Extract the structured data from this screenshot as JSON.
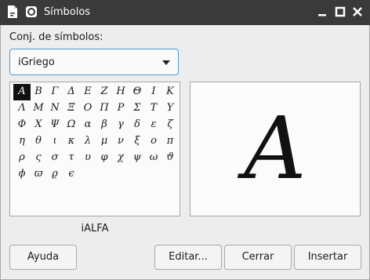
{
  "window": {
    "title": "Símbolos"
  },
  "symbol_set": {
    "label": "Conj. de símbolos:",
    "selected": "iGriego"
  },
  "symbols": [
    "Α",
    "Β",
    "Γ",
    "Δ",
    "Ε",
    "Ζ",
    "Η",
    "Θ",
    "Ι",
    "Κ",
    "Λ",
    "Μ",
    "Ν",
    "Ξ",
    "Ο",
    "Π",
    "Ρ",
    "Σ",
    "Τ",
    "Υ",
    "Φ",
    "Χ",
    "Ψ",
    "Ω",
    "α",
    "β",
    "γ",
    "δ",
    "ε",
    "ζ",
    "η",
    "θ",
    "ι",
    "κ",
    "λ",
    "μ",
    "ν",
    "ξ",
    "ο",
    "π",
    "ρ",
    "ς",
    "σ",
    "τ",
    "υ",
    "φ",
    "χ",
    "ψ",
    "ω",
    "ϑ",
    "ϕ",
    "ϖ",
    "ϱ",
    "ϵ"
  ],
  "preview": {
    "glyph": "Α",
    "name": "iALFA"
  },
  "buttons": {
    "help": "Ayuda",
    "edit": "Editar...",
    "close": "Cerrar",
    "insert": "Insertar"
  }
}
